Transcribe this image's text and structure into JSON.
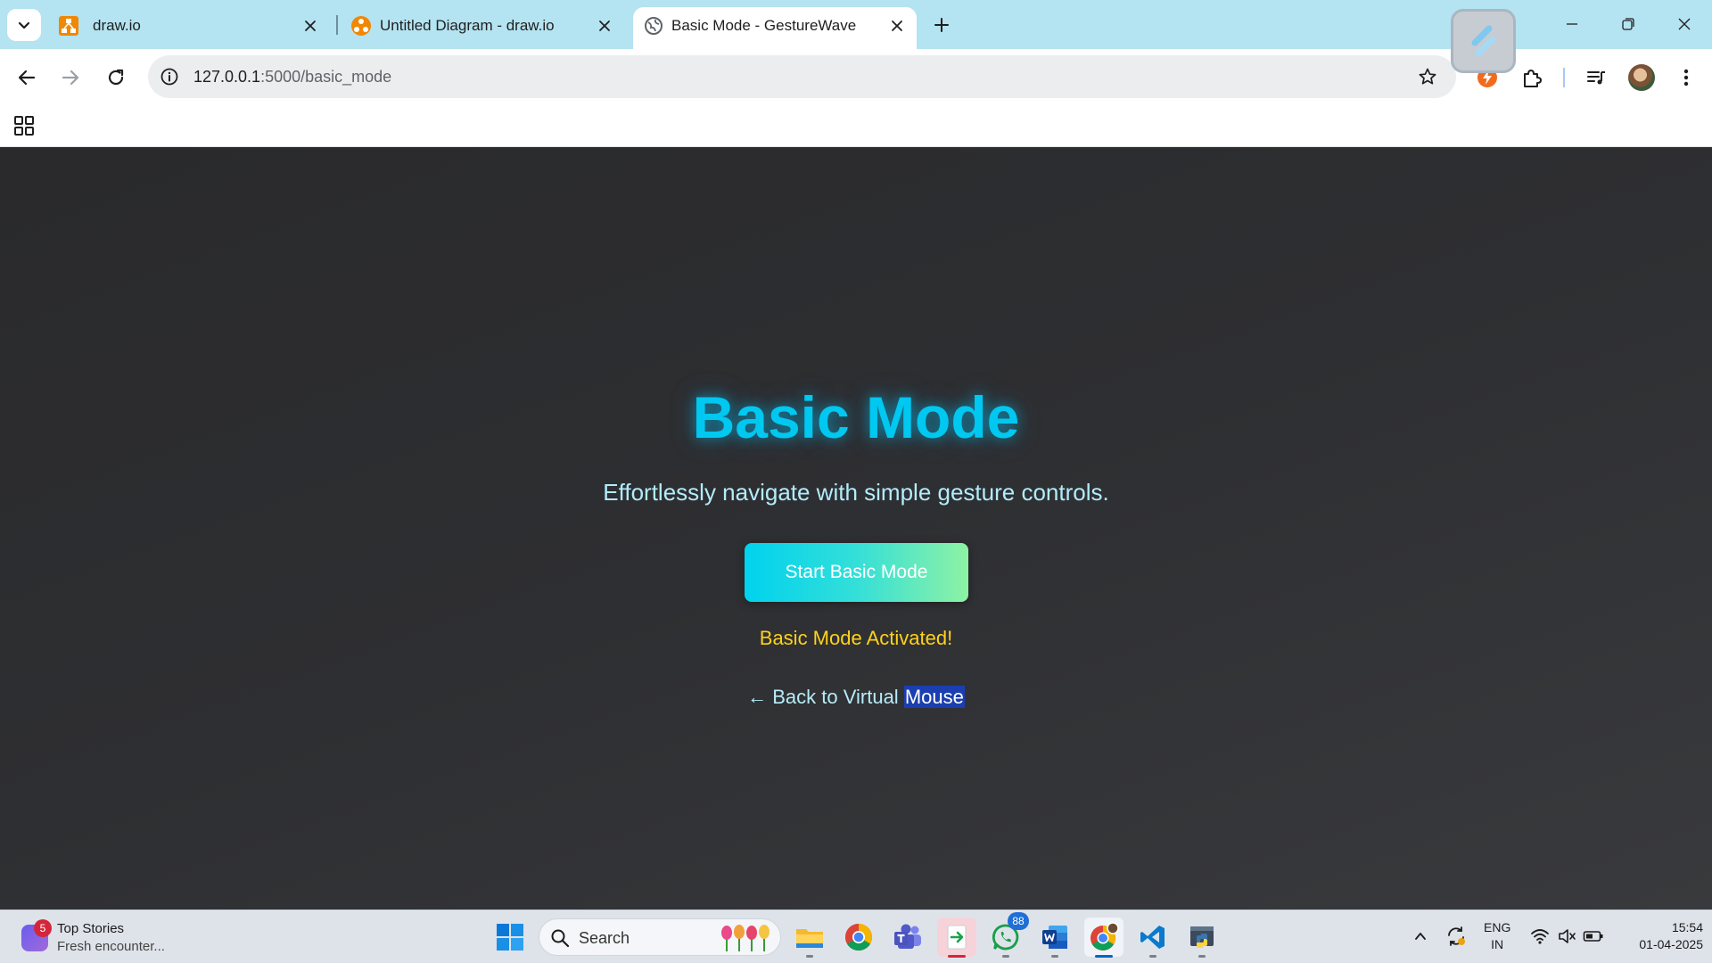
{
  "browser": {
    "tabs": [
      {
        "title": "draw.io",
        "active": false
      },
      {
        "title": "Untitled Diagram - draw.io",
        "active": false
      },
      {
        "title": "Basic Mode - GestureWave",
        "active": true
      }
    ],
    "address": {
      "host": "127.0.0.1",
      "path": ":5000/basic_mode"
    }
  },
  "page": {
    "heading": "Basic Mode",
    "subtitle": "Effortlessly navigate with simple gesture controls.",
    "start_button": "Start Basic Mode",
    "status": "Basic Mode Activated!",
    "back_link_prefix": "← Back to Virtual ",
    "back_link_highlight": "Mouse",
    "colors": {
      "heading": "#00c8f0",
      "status": "#ffd21a",
      "link": "#b6ecf8",
      "button_start": "#00d2ee",
      "button_end": "#8ef2a4"
    }
  },
  "taskbar": {
    "news": {
      "badge": "5",
      "title": "Top Stories",
      "subtitle": "Fresh encounter..."
    },
    "search_label": "Search",
    "whatsapp_count": "88",
    "language": {
      "line1": "ENG",
      "line2": "IN"
    },
    "time": "15:54",
    "date": "01-04-2025",
    "apps": [
      "file-explorer-icon",
      "chrome-icon",
      "teams-icon",
      "exit-app-icon",
      "whatsapp-icon",
      "word-icon",
      "chrome-profile-icon",
      "vscode-icon",
      "python-icon"
    ]
  }
}
